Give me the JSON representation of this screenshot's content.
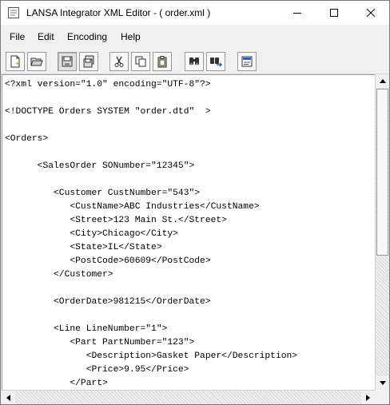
{
  "window": {
    "title": "LANSA Integrator XML Editor - ( order.xml )",
    "controls": [
      "minimize-icon",
      "maximize-icon",
      "close-icon"
    ]
  },
  "menu": {
    "items": [
      "File",
      "Edit",
      "Encoding",
      "Help"
    ]
  },
  "toolbar": {
    "buttons": [
      {
        "icon": "new-file-icon"
      },
      {
        "icon": "open-folder-icon"
      },
      {
        "icon": "save-icon",
        "state": "pressed"
      },
      {
        "icon": "save-all-icon"
      },
      {
        "icon": "cut-icon"
      },
      {
        "icon": "copy-icon"
      },
      {
        "icon": "paste-icon"
      },
      {
        "icon": "find-icon"
      },
      {
        "icon": "find-next-icon"
      },
      {
        "icon": "properties-icon"
      }
    ]
  },
  "editor": {
    "lines": [
      "<?xml version=\"1.0\" encoding=\"UTF-8\"?>",
      "",
      "<!DOCTYPE Orders SYSTEM \"order.dtd\"  >",
      "",
      "<Orders>",
      "",
      "      <SalesOrder SONumber=\"12345\">",
      "",
      "         <Customer CustNumber=\"543\">",
      "            <CustName>ABC Industries</CustName>",
      "            <Street>123 Main St.</Street>",
      "            <City>Chicago</City>",
      "            <State>IL</State>",
      "            <PostCode>60609</PostCode>",
      "         </Customer>",
      "",
      "         <OrderDate>981215</OrderDate>",
      "",
      "         <Line LineNumber=\"1\">",
      "            <Part PartNumber=\"123\">",
      "               <Description>Gasket Paper</Description>",
      "               <Price>9.95</Price>",
      "            </Part>"
    ]
  },
  "colors": {
    "chrome": "#f0f0f0",
    "editor_bg": "#ffffff",
    "text": "#000000"
  }
}
